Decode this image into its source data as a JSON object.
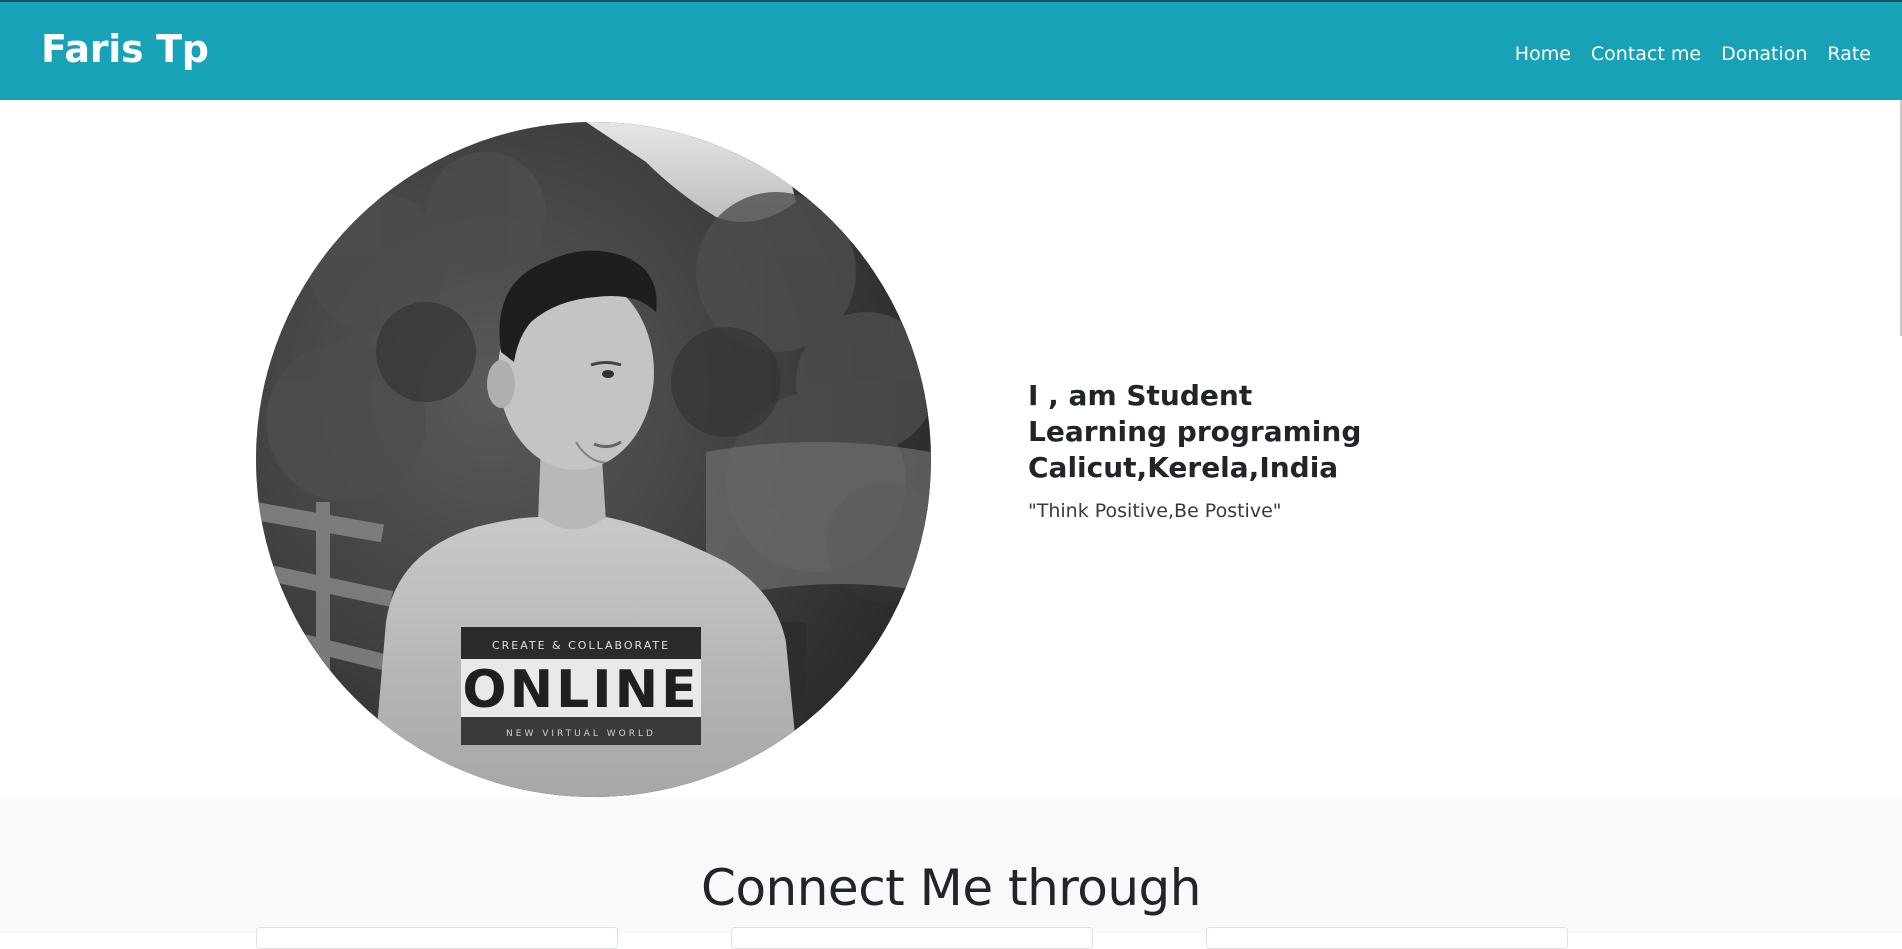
{
  "navbar": {
    "brand": "Faris Tp",
    "links": [
      {
        "label": "Home"
      },
      {
        "label": "Contact me"
      },
      {
        "label": "Donation"
      },
      {
        "label": "Rate"
      }
    ]
  },
  "hero": {
    "lines": [
      "I , am Student",
      "Learning programing",
      "Calicut,Kerela,India"
    ],
    "quote": "\"Think Positive,Be Postive\"",
    "photo_shirt_text": {
      "top": "CREATE & COLLABORATE",
      "main": "ONLINE",
      "bottom": "NEW VIRTUAL WORLD"
    }
  },
  "connect": {
    "title": "Connect Me through"
  },
  "colors": {
    "navbar_bg": "#17a2b8",
    "section_bg": "#f8f9fa",
    "text": "#212529"
  }
}
